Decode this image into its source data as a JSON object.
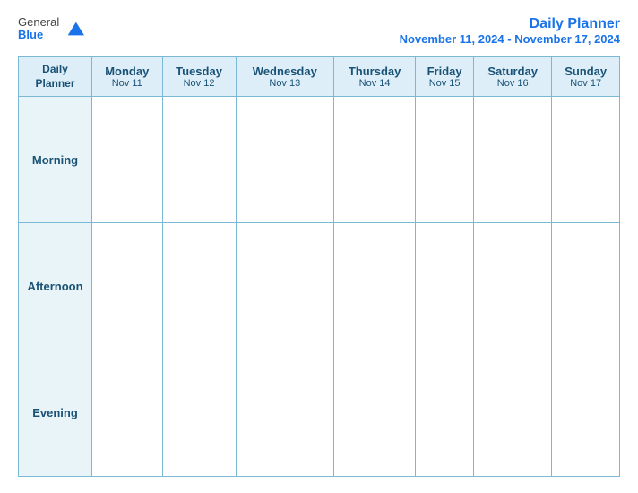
{
  "logo": {
    "general": "General",
    "blue": "Blue"
  },
  "header": {
    "title": "Daily Planner",
    "date_range": "November 11, 2024 - November 17, 2024"
  },
  "table": {
    "label_header_line1": "Daily",
    "label_header_line2": "Planner",
    "columns": [
      {
        "day": "Monday",
        "date": "Nov 11"
      },
      {
        "day": "Tuesday",
        "date": "Nov 12"
      },
      {
        "day": "Wednesday",
        "date": "Nov 13"
      },
      {
        "day": "Thursday",
        "date": "Nov 14"
      },
      {
        "day": "Friday",
        "date": "Nov 15"
      },
      {
        "day": "Saturday",
        "date": "Nov 16"
      },
      {
        "day": "Sunday",
        "date": "Nov 17"
      }
    ],
    "rows": [
      {
        "label": "Morning"
      },
      {
        "label": "Afternoon"
      },
      {
        "label": "Evening"
      }
    ]
  }
}
